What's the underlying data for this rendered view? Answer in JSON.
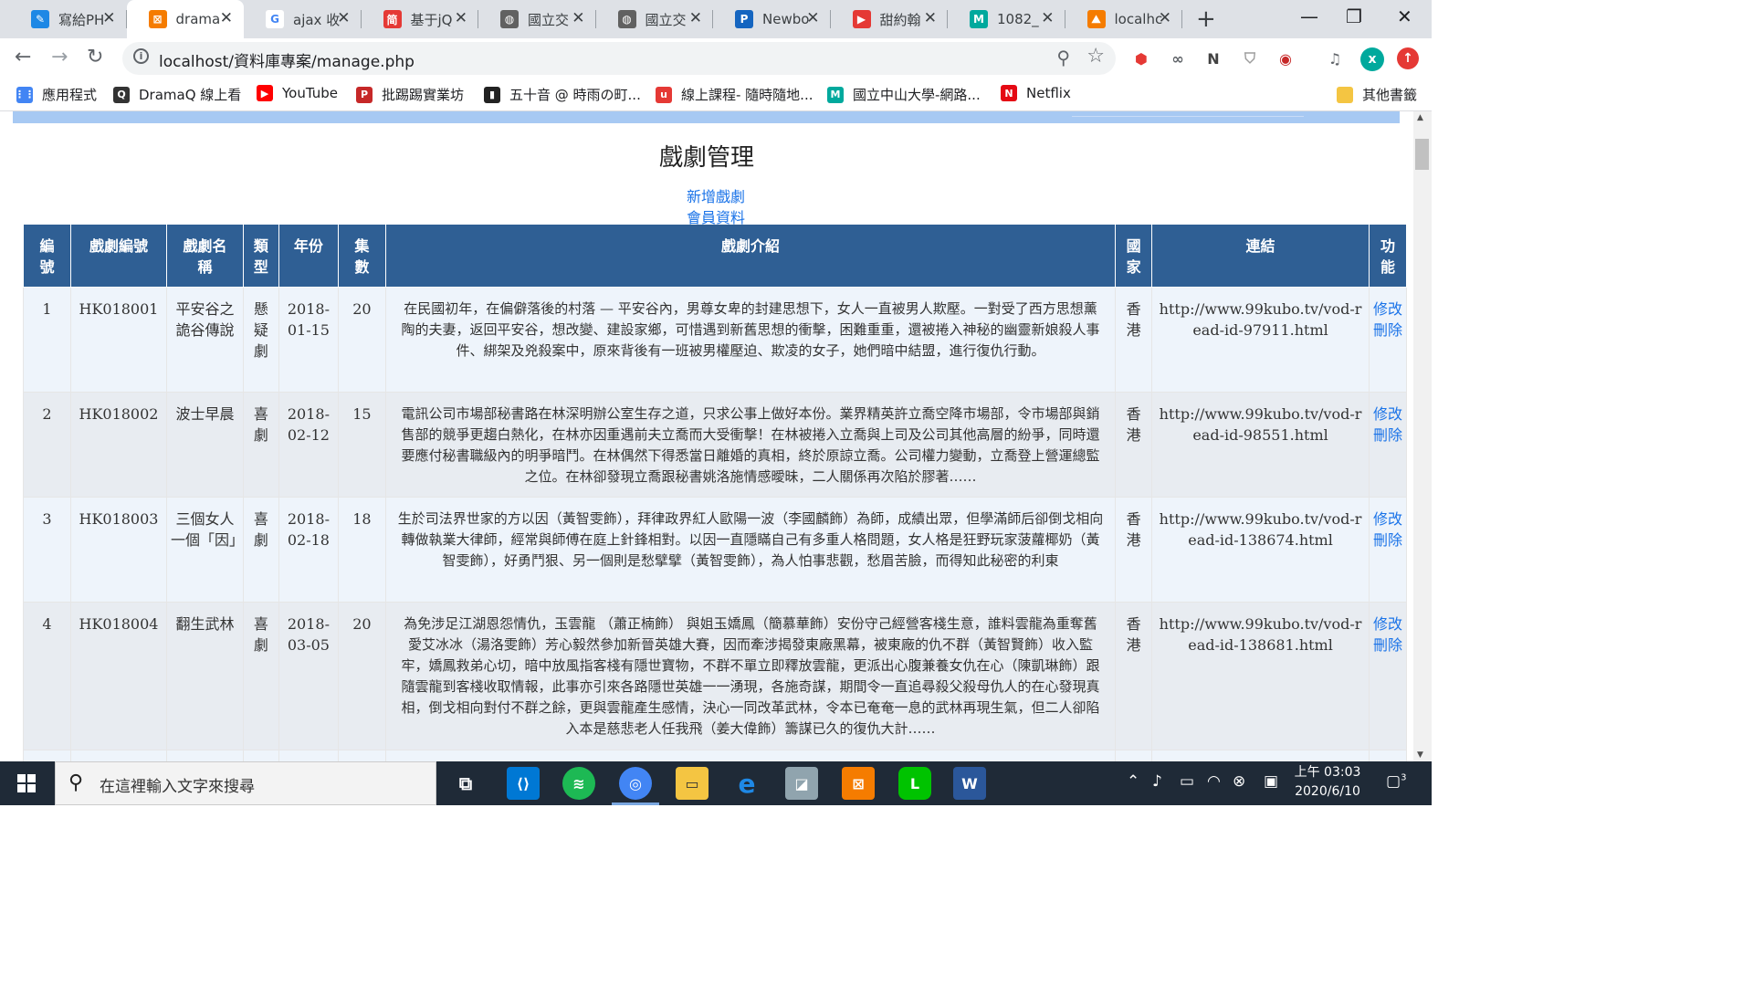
{
  "browser": {
    "tabs": [
      {
        "label": "寫給PH",
        "icon_color": "#1e88e5",
        "icon": "✎"
      },
      {
        "label": "drama",
        "icon_color": "#f57c00",
        "icon": "⊠",
        "active": true
      },
      {
        "label": "ajax 收",
        "icon_color": "#ffffff",
        "icon": "G"
      },
      {
        "label": "基于jQ",
        "icon_color": "#e53935",
        "icon": "简"
      },
      {
        "label": "國立交",
        "icon_color": "#616161",
        "icon": "◍"
      },
      {
        "label": "國立交",
        "icon_color": "#616161",
        "icon": "◍"
      },
      {
        "label": "Newbo",
        "icon_color": "#1565c0",
        "icon": "P"
      },
      {
        "label": "甜約翰",
        "icon_color": "#e53935",
        "icon": "▶"
      },
      {
        "label": "1082_",
        "icon_color": "#00a99d",
        "icon": "M"
      },
      {
        "label": "localhc",
        "icon_color": "#f57c00",
        "icon": "⛰"
      }
    ],
    "url": "localhost/資料庫專案/manage.php",
    "bookmarks": [
      {
        "label": "應用程式",
        "icon": "⋮⋮",
        "color": "#4285f4"
      },
      {
        "label": "DramaQ 線上看",
        "icon": "Q",
        "color": "#333333"
      },
      {
        "label": "YouTube",
        "icon": "▶",
        "color": "#ff0000"
      },
      {
        "label": "批踢踢實業坊",
        "icon": "P",
        "color": "#c62828"
      },
      {
        "label": "五十音 @ 時雨の町...",
        "icon": "▮",
        "color": "#222222"
      },
      {
        "label": "線上課程- 隨時隨地...",
        "icon": "u",
        "color": "#e53935"
      },
      {
        "label": "國立中山大學-網路...",
        "icon": "M",
        "color": "#00a99d"
      },
      {
        "label": "Netflix",
        "icon": "N",
        "color": "#e50914"
      }
    ],
    "other_bookmarks": "其他書籤"
  },
  "page": {
    "title": "戲劇管理",
    "links": [
      "新增戲劇",
      "會員資料"
    ],
    "headers": [
      "編號",
      "戲劇編號",
      "戲劇名稱",
      "類型",
      "年份",
      "集數",
      "戲劇介紹",
      "國家",
      "連結",
      "功能"
    ],
    "rows": [
      {
        "no": "1",
        "code": "HK018001",
        "name": "平安谷之詭谷傳說",
        "type": "懸疑劇",
        "date": "2018-01-15",
        "eps": "20",
        "intro": "在民國初年，在偏僻落後的村落 — 平安谷內，男尊女卑的封建思想下，女人一直被男人欺壓。一對受了西方思想薰陶的夫妻，返回平安谷，想改變、建設家鄉，可惜遇到新舊思想的衝擊，困難重重，還被捲入神秘的幽靈新娘殺人事件、綁架及兇殺案中，原來背後有一班被男權壓迫、欺凌的女子，她們暗中結盟，進行復仇行動。",
        "country": "香港",
        "link": "http://www.99kubo.tv/vod-read-id-97911.html",
        "edit": "修改",
        "del": "刪除"
      },
      {
        "no": "2",
        "code": "HK018002",
        "name": "波士早晨",
        "type": "喜劇",
        "date": "2018-02-12",
        "eps": "15",
        "intro": "電訊公司市場部秘書路在林深明辦公室生存之道，只求公事上做好本份。業界精英許立喬空降市場部，令市場部與銷售部的競爭更趨白熱化，在林亦因重遇前夫立喬而大受衝擊！在林被捲入立喬與上司及公司其他高層的紛爭，同時還要應付秘書職級內的明爭暗鬥。在林偶然下得悉當日離婚的真相，終於原諒立喬。公司權力變動，立喬登上營運總監之位。在林卻發現立喬跟秘書姚洛施情感曖昧，二人關係再次陷於膠著……",
        "country": "香港",
        "link": "http://www.99kubo.tv/vod-read-id-98551.html",
        "edit": "修改",
        "del": "刪除"
      },
      {
        "no": "3",
        "code": "HK018003",
        "name": "三個女人一個「因」",
        "type": "喜劇",
        "date": "2018-02-18",
        "eps": "18",
        "intro": "生於司法界世家的方以因（黃智雯飾），拜律政界紅人歐陽一波（李國麟飾）為師，成績出眾，但學滿師后卻倒戈相向轉做執業大律師，經常與師傅在庭上針鋒相對。以因一直隱瞞自己有多重人格問題，女人格是狂野玩家菠蘿椰奶（黃智雯飾），好勇鬥狠、另一個則是愁擘擘（黃智雯飾），為人怕事悲觀，愁眉苦臉，而得知此秘密的利東",
        "country": "香港",
        "link": "http://www.99kubo.tv/vod-read-id-138674.html",
        "edit": "修改",
        "del": "刪除"
      },
      {
        "no": "4",
        "code": "HK018004",
        "name": "翻生武林",
        "type": "喜劇",
        "date": "2018-03-05",
        "eps": "20",
        "intro": "為免涉足江湖恩怨情仇，玉雲龍 （蕭正楠飾） 與姐玉嬌鳳（簡慕華飾）安份守己經營客棧生意，誰料雲龍為重奪舊愛艾冰冰（湯洛雯飾）芳心毅然參加新晉英雄大賽，因而牽涉揭發東廠黑幕，被東廠的仇不群（黃智賢飾）收入監牢，嬌鳳救弟心切，暗中放風指客棧有隱世寶物，不群不單立即釋放雲龍，更派出心腹兼養女仇在心（陳凱琳飾）跟隨雲龍到客棧收取情報，此事亦引來各路隱世英雄一一湧現，各施奇謀，期間令一直追尋殺父殺母仇人的在心發現真相，倒戈相向對付不群之餘，更與雲龍產生感情，決心一同改革武林，令本已奄奄一息的武林再現生氣，但二人卻陷入本是慈悲老人任我飛（姜大偉飾）籌謀已久的復仇大計……",
        "country": "香港",
        "link": "http://www.99kubo.tv/vod-read-id-138681.html",
        "edit": "修改",
        "del": "刪除"
      }
    ]
  },
  "taskbar": {
    "search_placeholder": "在這裡輸入文字來搜尋",
    "time": "上午 03:03",
    "date": "2020/6/10",
    "notifications": "3"
  }
}
